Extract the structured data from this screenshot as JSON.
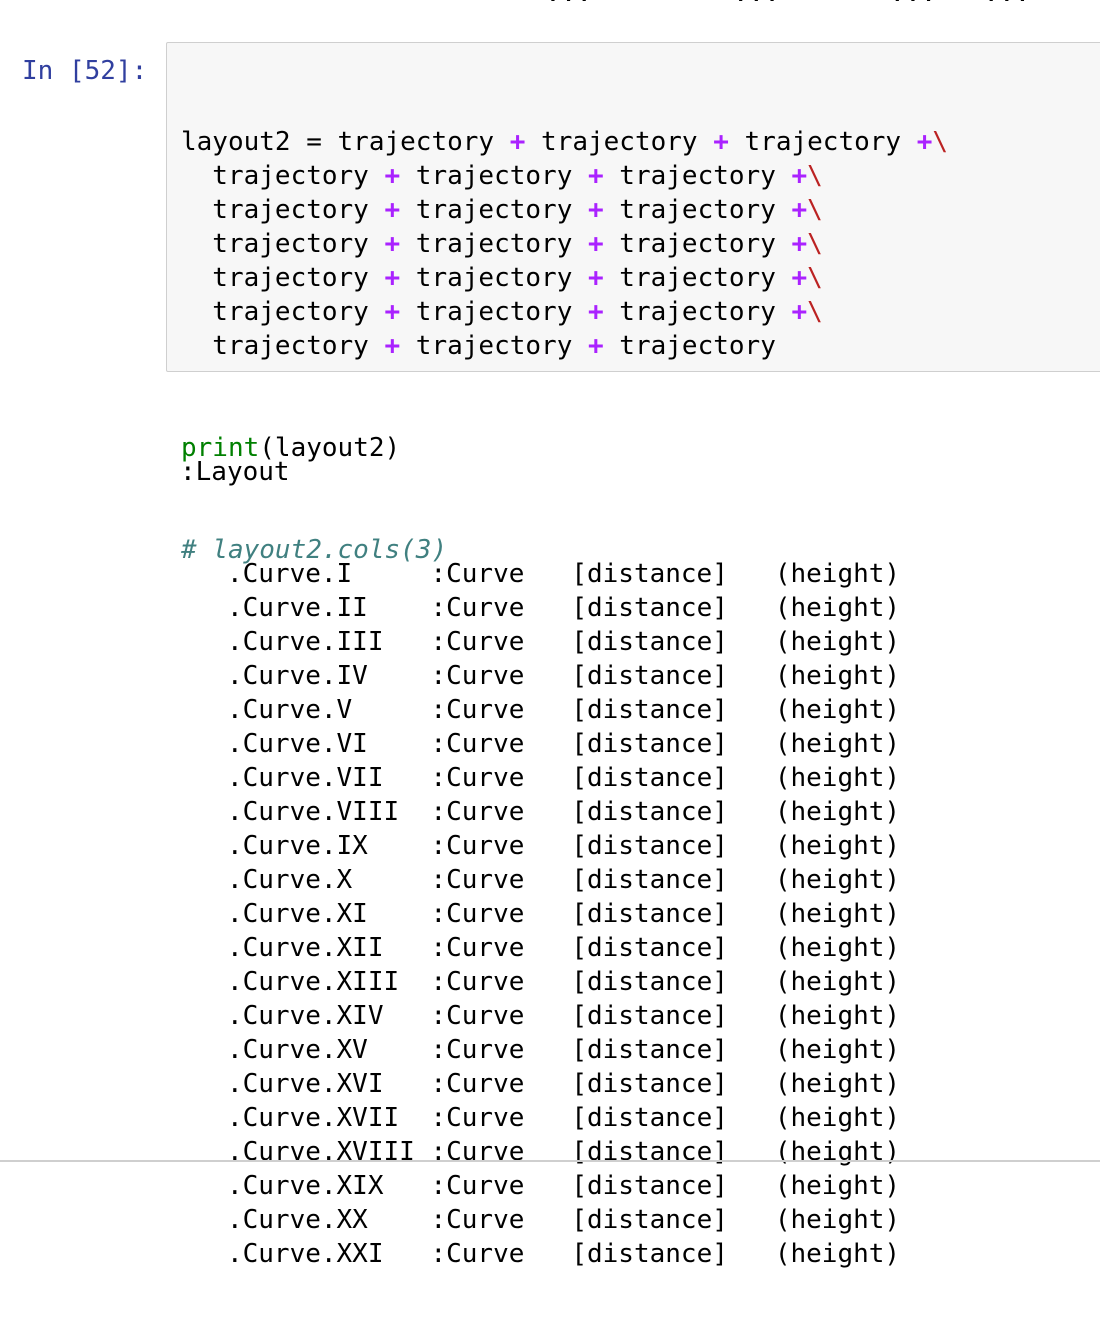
{
  "notebook": {
    "prev_output_fragment": "                    ...         ...       ...   ...",
    "cell": {
      "prompt": "In [52]:",
      "code_lines": [
        [
          "layout2 = trajectory ",
          "+",
          " trajectory ",
          "+",
          " trajectory ",
          "+",
          "\\"
        ],
        [
          "  trajectory ",
          "+",
          " trajectory ",
          "+",
          " trajectory ",
          "+",
          "\\"
        ],
        [
          "  trajectory ",
          "+",
          " trajectory ",
          "+",
          " trajectory ",
          "+",
          "\\"
        ],
        [
          "  trajectory ",
          "+",
          " trajectory ",
          "+",
          " trajectory ",
          "+",
          "\\"
        ],
        [
          "  trajectory ",
          "+",
          " trajectory ",
          "+",
          " trajectory ",
          "+",
          "\\"
        ],
        [
          "  trajectory ",
          "+",
          " trajectory ",
          "+",
          " trajectory ",
          "+",
          "\\"
        ],
        [
          "  trajectory ",
          "+",
          " trajectory ",
          "+",
          " trajectory",
          "",
          ""
        ]
      ],
      "print_keyword": "print",
      "print_rest": "(layout2)",
      "comment": "# layout2.cols(3)"
    },
    "output": {
      "header": ":Layout",
      "rows": [
        [
          "   .Curve.I",
          "     :Curve",
          "   [distance]",
          "   (height)"
        ],
        [
          "   .Curve.II",
          "    :Curve",
          "   [distance]",
          "   (height)"
        ],
        [
          "   .Curve.III",
          "   :Curve",
          "   [distance]",
          "   (height)"
        ],
        [
          "   .Curve.IV",
          "    :Curve",
          "   [distance]",
          "   (height)"
        ],
        [
          "   .Curve.V",
          "     :Curve",
          "   [distance]",
          "   (height)"
        ],
        [
          "   .Curve.VI",
          "    :Curve",
          "   [distance]",
          "   (height)"
        ],
        [
          "   .Curve.VII",
          "   :Curve",
          "   [distance]",
          "   (height)"
        ],
        [
          "   .Curve.VIII",
          "  :Curve",
          "   [distance]",
          "   (height)"
        ],
        [
          "   .Curve.IX",
          "    :Curve",
          "   [distance]",
          "   (height)"
        ],
        [
          "   .Curve.X",
          "     :Curve",
          "   [distance]",
          "   (height)"
        ],
        [
          "   .Curve.XI",
          "    :Curve",
          "   [distance]",
          "   (height)"
        ],
        [
          "   .Curve.XII",
          "   :Curve",
          "   [distance]",
          "   (height)"
        ],
        [
          "   .Curve.XIII",
          "  :Curve",
          "   [distance]",
          "   (height)"
        ],
        [
          "   .Curve.XIV",
          "   :Curve",
          "   [distance]",
          "   (height)"
        ],
        [
          "   .Curve.XV",
          "    :Curve",
          "   [distance]",
          "   (height)"
        ],
        [
          "   .Curve.XVI",
          "   :Curve",
          "   [distance]",
          "   (height)"
        ],
        [
          "   .Curve.XVII",
          "  :Curve",
          "   [distance]",
          "   (height)"
        ],
        [
          "   .Curve.XVIII",
          " :Curve",
          "   [distance]",
          "   (height)"
        ],
        [
          "   .Curve.XIX",
          "   :Curve",
          "   [distance]",
          "   (height)"
        ],
        [
          "   .Curve.XX",
          "    :Curve",
          "   [distance]",
          "   (height)"
        ],
        [
          "   .Curve.XXI",
          "   :Curve",
          "   [distance]",
          "   (height)"
        ]
      ]
    },
    "colors": {
      "prompt": "#303f9f",
      "operator": "#aa22ff",
      "backslash": "#bb2222",
      "builtin": "#008000",
      "comment": "#408080",
      "cell_background": "#f7f7f7",
      "cell_border": "#cfcfcf"
    }
  }
}
